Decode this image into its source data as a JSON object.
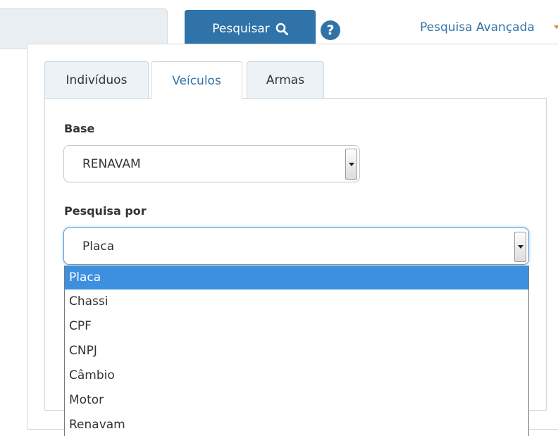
{
  "header": {
    "search_button_label": "Pesquisar",
    "help_icon": "?",
    "advanced_search_label": "Pesquisa Avançada"
  },
  "tabs": [
    {
      "label": "Indivíduos"
    },
    {
      "label": "Veículos"
    },
    {
      "label": "Armas"
    }
  ],
  "form": {
    "base_label": "Base",
    "base_value": "RENAVAM",
    "search_by_label": "Pesquisa por",
    "search_by_value": "Placa",
    "search_by_options": [
      "Placa",
      "Chassi",
      "CPF",
      "CNPJ",
      "Câmbio",
      "Motor",
      "Renavam"
    ]
  },
  "colors": {
    "accent": "#2f73a8",
    "dropdown_selected": "#3d8fe0",
    "advanced_caret": "#e08a2c"
  }
}
